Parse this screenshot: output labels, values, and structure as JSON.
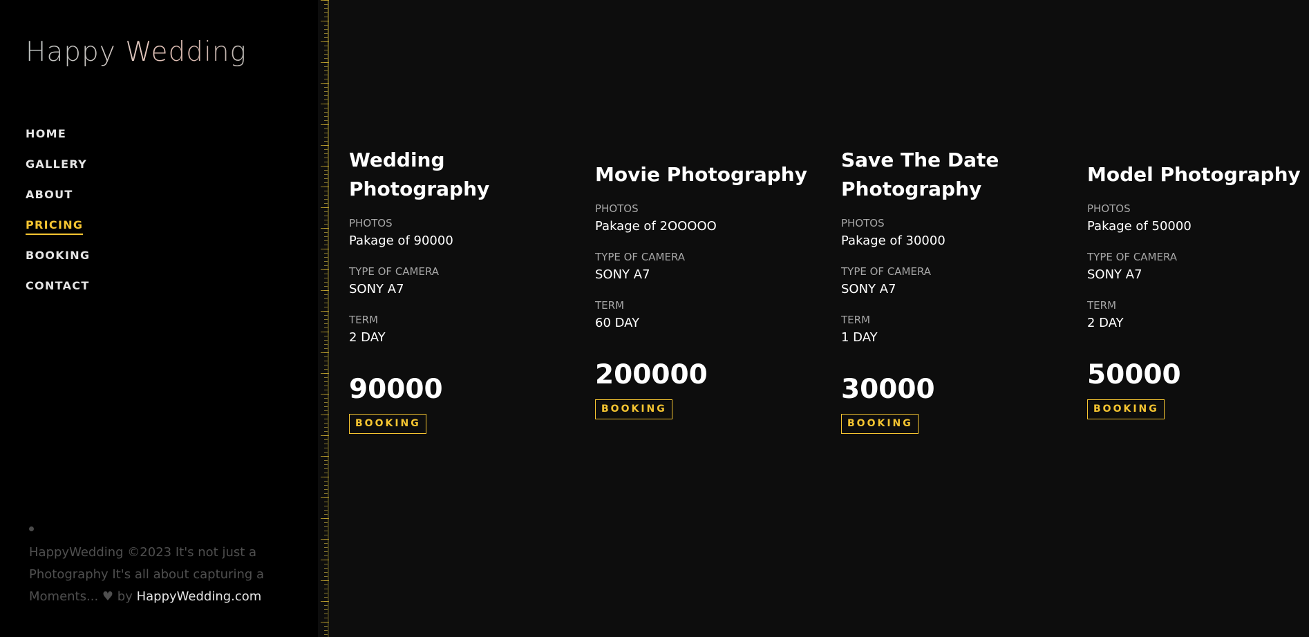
{
  "brand": {
    "name": "Happy Wedding"
  },
  "nav": {
    "items": [
      {
        "label": "HOME"
      },
      {
        "label": "GALLERY"
      },
      {
        "label": "ABOUT"
      },
      {
        "label": "PRICING",
        "active": true
      },
      {
        "label": "BOOKING"
      },
      {
        "label": "CONTACT"
      }
    ]
  },
  "footer": {
    "text": "HappyWedding ©2023 It's not just a Photography It's all about capturing a Moments...",
    "heart": "♥",
    "by": "by",
    "link": "HappyWedding.com"
  },
  "labels": {
    "photos": "PHOTOS",
    "camera": "TYPE OF CAMERA",
    "term": "TERM",
    "button": "BOOKING"
  },
  "cards": [
    {
      "title": "Wedding Photography",
      "photos": "Pakage of 90000",
      "camera": "SONY A7",
      "term": "2 DAY",
      "price": "90000"
    },
    {
      "title": "Movie Photography",
      "photos": "Pakage of 2OOOOO",
      "camera": "SONY A7",
      "term": "60 DAY",
      "price": "200000"
    },
    {
      "title": "Save The Date Photography",
      "photos": "Pakage of 30000",
      "camera": "SONY A7",
      "term": "1 DAY",
      "price": "30000"
    },
    {
      "title": "Model Photography",
      "photos": "Pakage of 50000",
      "camera": "SONY A7",
      "term": "2 DAY",
      "price": "50000"
    }
  ],
  "colors": {
    "accent": "#f5c531",
    "sidebar_bg": "#000000",
    "main_bg": "#0d0d0d",
    "muted_text": "#4f4f4f"
  }
}
